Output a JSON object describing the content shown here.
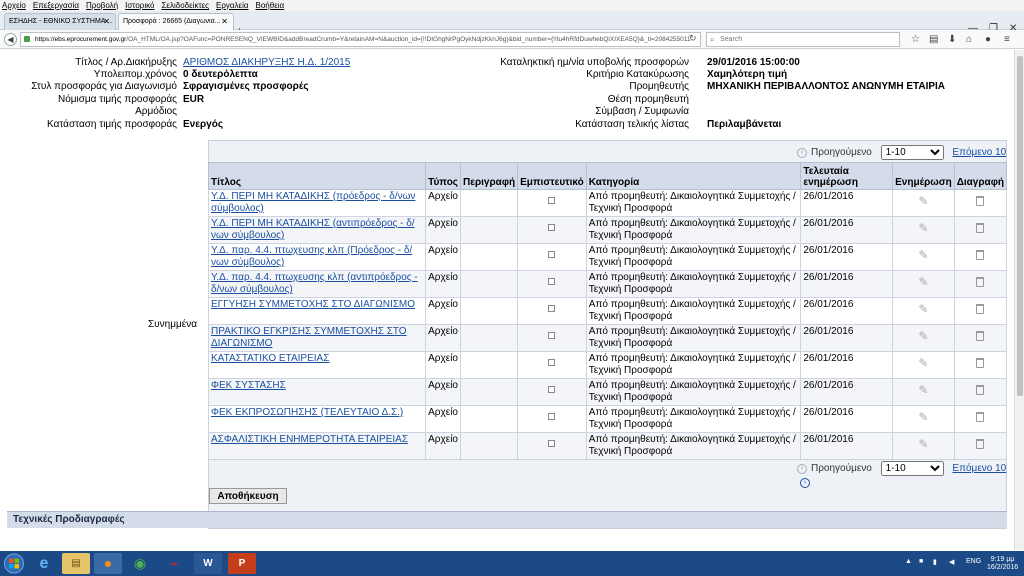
{
  "browser": {
    "menu": [
      "Αρχείο",
      "Επεξεργασία",
      "Προβολή",
      "Ιστορικό",
      "Σελιδοδείκτες",
      "Εργαλεία",
      "Βοήθεια"
    ],
    "tabs": [
      {
        "label": "ΕΣΗΔΗΣ - ΕΘΝΙΚΟ ΣΥΣΤΗΜΑ ..."
      },
      {
        "label": "Προσφορά : 26665 (Διαγωνια..."
      }
    ],
    "url_host": "https://ebs.eprocurement.gov.gr",
    "url_path": "/OA_HTML/OA.jsp?OAFunc=PONRESENQ_VIEWBID&addBreadCrumb=Y&retainAM=N&auction_id={!!DIGhgNrPgOykNdjzKknJ6g}&bid_number={!!tu4hRfdDuwhebQiXIXEA5Q}&_ti=2084255011",
    "search_placeholder": "Search"
  },
  "header_fields": {
    "left": [
      {
        "label": "Τίτλος / Αρ.Διακήρυξης",
        "value": "ΑΡΙΘΜΟΣ ΔΙΑΚΗΡΥΞΗΣ Η.Δ. 1/2015"
      },
      {
        "label": "Υπολειπομ.χρόνος",
        "value": "0 δευτερόλεπτα"
      },
      {
        "label": "Στυλ προσφοράς για Διαγωνισμό",
        "value": "Σφραγισμένες προσφορές"
      },
      {
        "label": "Νόμισμα τιμής προσφοράς",
        "value": "EUR"
      },
      {
        "label": "Αρμόδιος",
        "value": ""
      },
      {
        "label": "Κατάσταση τιμής προσφοράς",
        "value": "Ενεργός"
      }
    ],
    "right": [
      {
        "label": "Καταληκτική ημ/νία υποβολής προσφορών",
        "value": "29/01/2016 15:00:00"
      },
      {
        "label": "Κριτήριο Κατακύρωσης",
        "value": "Χαμηλότερη τιμή"
      },
      {
        "label": "Προμηθευτής",
        "value": "ΜΗΧΑΝΙΚΗ ΠΕΡΙΒΑΛΛΟΝΤΟΣ ΑΝΩΝΥΜΗ ΕΤΑΙΡΙΑ"
      },
      {
        "label": "Θέση προμηθευτή",
        "value": ""
      },
      {
        "label": "Σύμβαση / Συμφωνία",
        "value": ""
      },
      {
        "label": "Κατάσταση τελικής λίστας",
        "value": "Περιλαμβάνεται"
      }
    ]
  },
  "attachments": {
    "section_label": "Συνημμένα",
    "pager": {
      "prev": "Προηγούμενο",
      "range": "1-10",
      "next": "Επόμενο 10"
    },
    "columns": [
      "Τίτλος",
      "Τύπος",
      "Περιγραφή",
      "Εμπιστευτικό",
      "Κατηγορία",
      "Τελευταία ενημέρωση",
      "Ενημέρωση",
      "Διαγραφή"
    ],
    "rows": [
      {
        "title": "Υ.Δ. ΠΕΡΙ ΜΗ ΚΑΤΑΔΙΚΗΣ (πρόεδρος - δ/νων σύμβουλος)",
        "type": "Αρχείο",
        "description": "",
        "category": "Από προμηθευτή: Δικαιολογητικά Συμμετοχής /Τεχνική Προσφορά",
        "updated": "26/01/2016"
      },
      {
        "title": "Υ.Δ. ΠΕΡΙ ΜΗ ΚΑΤΑΔΙΚΗΣ (αντιπρόεδρος - δ/νων σύμβουλος)",
        "type": "Αρχείο",
        "description": "",
        "category": "Από προμηθευτή: Δικαιολογητικά Συμμετοχής /Τεχνική Προσφορά",
        "updated": "26/01/2016"
      },
      {
        "title": "Υ.Δ. παρ. 4.4. πτωχευσης κλπ (Πρόεδρος - δ/νων σύμβουλος)",
        "type": "Αρχείο",
        "description": "",
        "category": "Από προμηθευτή: Δικαιολογητικά Συμμετοχής /Τεχνική Προσφορά",
        "updated": "26/01/2016"
      },
      {
        "title": "Υ.Δ. παρ. 4.4. πτωχευσης κλπ (αντιπρόεδρος - δ/νων σύμβουλος)",
        "type": "Αρχείο",
        "description": "",
        "category": "Από προμηθευτή: Δικαιολογητικά Συμμετοχής /Τεχνική Προσφορά",
        "updated": "26/01/2016"
      },
      {
        "title": "ΕΓΓΥΗΣΗ ΣΥΜΜΕΤΟΧΗΣ ΣΤΟ ΔΙΑΓΩΝΙΣΜΟ",
        "type": "Αρχείο",
        "description": "",
        "category": "Από προμηθευτή: Δικαιολογητικά Συμμετοχής /Τεχνική Προσφορά",
        "updated": "26/01/2016"
      },
      {
        "title": "ΠΡΑΚΤΙΚΟ ΕΓΚΡΙΣΗΣ ΣΥΜΜΕΤΟΧΗΣ ΣΤΟ ΔΙΑΓΩΝΙΣΜΟ",
        "type": "Αρχείο",
        "description": "",
        "category": "Από προμηθευτή: Δικαιολογητικά Συμμετοχής /Τεχνική Προσφορά",
        "updated": "26/01/2016"
      },
      {
        "title": "ΚΑΤΑΣΤΑΤΙΚΟ ΕΤΑΙΡΕΙΑΣ",
        "type": "Αρχείο",
        "description": "",
        "category": "Από προμηθευτή: Δικαιολογητικά Συμμετοχής /Τεχνική Προσφορά",
        "updated": "26/01/2016"
      },
      {
        "title": "ΦΕΚ ΣΥΣΤΑΣΗΣ",
        "type": "Αρχείο",
        "description": "",
        "category": "Από προμηθευτή: Δικαιολογητικά Συμμετοχής /Τεχνική Προσφορά",
        "updated": "26/01/2016"
      },
      {
        "title": "ΦΕΚ ΕΚΠΡΟΣΩΠΗΣΗΣ (ΤΕΛΕΥΤΑΙΟ Δ.Σ.)",
        "type": "Αρχείο",
        "description": "",
        "category": "Από προμηθευτή: Δικαιολογητικά Συμμετοχής /Τεχνική Προσφορά",
        "updated": "26/01/2016"
      },
      {
        "title": "ΑΣΦΑΛΙΣΤΙΚΗ ΕΝΗΜΕΡΟΤΗΤΑ ΕΤΑΙΡΕΙΑΣ",
        "type": "Αρχείο",
        "description": "",
        "category": "Από προμηθευτή: Δικαιολογητικά Συμμετοχής /Τεχνική Προσφορά",
        "updated": "26/01/2016"
      }
    ]
  },
  "save_button": "Αποθήκευση",
  "section_title": "Τεχνικές Προδιαγραφές",
  "taskbar": {
    "lang": "ENG",
    "time": "9:19 μμ",
    "date": "16/2/2016"
  },
  "colors": {
    "link": "#1a4fa0",
    "header_bg": "#d4dcea",
    "taskbar": "#1c4a86"
  }
}
